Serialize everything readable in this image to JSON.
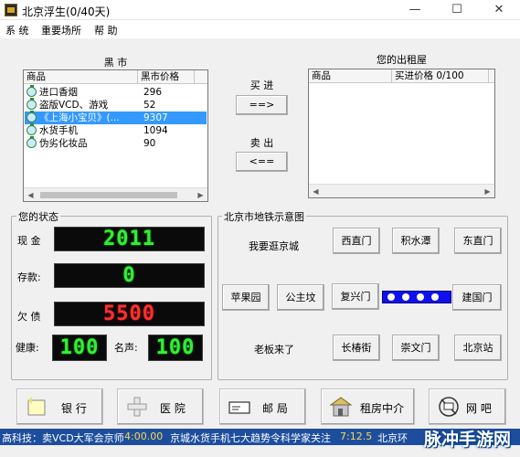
{
  "window": {
    "title": "北京浮生(0/40天)",
    "min_glyph": "—",
    "max_glyph": "☐",
    "close_glyph": "✕"
  },
  "menu": [
    "系 统",
    "重要场所",
    "帮 助"
  ],
  "black_market": {
    "caption": "黑 市",
    "columns": [
      "商品",
      "黑市价格"
    ],
    "items": [
      {
        "name": "进口香烟",
        "price": "296"
      },
      {
        "name": "盗版VCD、游戏",
        "price": "52"
      },
      {
        "name": "《上海小宝贝》(...",
        "price": "9307"
      },
      {
        "name": "水货手机",
        "price": "1094"
      },
      {
        "name": "伪劣化妆品",
        "price": "90"
      }
    ],
    "selected_index": 2
  },
  "trade": {
    "buy_label": "买 进",
    "buy_button": "==>",
    "sell_label": "卖 出",
    "sell_button": "<=="
  },
  "rental": {
    "caption": "您的出租屋",
    "columns": [
      "商品",
      "买进价格 0/100"
    ]
  },
  "status": {
    "caption": "您的状态",
    "cash_label": "现 金",
    "cash_value": "2011",
    "savings_label": "存款:",
    "savings_value": "0",
    "debt_label": "欠 债",
    "debt_value": "5500",
    "health_label": "健康:",
    "health_value": "100",
    "fame_label": "名声:",
    "fame_value": "100"
  },
  "map": {
    "caption": "北京市地铁示意图",
    "wander_label": "我要逛京城",
    "boss_label": "老板来了",
    "stations": [
      "西直门",
      "积水潭",
      "东直门",
      "苹果园",
      "公主坟",
      "复兴门",
      "建国门",
      "长椿街",
      "崇文门",
      "北京站"
    ]
  },
  "bottom_buttons": [
    {
      "label": "银 行",
      "icon": "bank-icon"
    },
    {
      "label": "医 院",
      "icon": "hospital-icon"
    },
    {
      "label": "邮 局",
      "icon": "post-office-icon"
    },
    {
      "label": "租房中介",
      "icon": "rental-agency-icon"
    },
    {
      "label": "网 吧",
      "icon": "internet-cafe-icon"
    }
  ],
  "ticker": {
    "items": [
      "高科技：卖VCD大军会京师",
      "4:00.00",
      "京城水货手机七大趋势令科学家关注",
      "7:12.5",
      "北京环"
    ]
  },
  "watermark": "脉冲手游网",
  "colors": {
    "led_green": "#33ee33",
    "led_red": "#ff3030",
    "metro_line": "#1010ee",
    "selection": "#3399ff",
    "ticker_bg": "#1d4e9e"
  }
}
